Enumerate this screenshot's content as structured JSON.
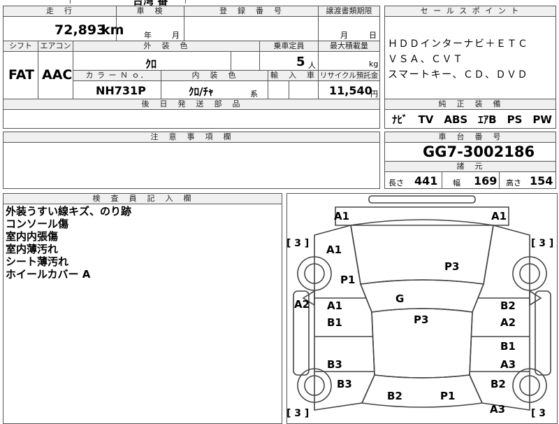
{
  "top_partial": {
    "text": "台湾 番"
  },
  "mileage": {
    "header": "走　行",
    "value": "72,893",
    "unit": "km"
  },
  "inspection": {
    "header": "車　検",
    "year_unit": "年",
    "month_unit": "月"
  },
  "registration": {
    "header": "登　録　番　号"
  },
  "transfer": {
    "header": "譲渡書類期限",
    "month_unit": "月",
    "day_unit": "日"
  },
  "shift": {
    "header": "シフト",
    "value": "FAT"
  },
  "aircon": {
    "header": "エアコン",
    "value": "AAC"
  },
  "exterior_color": {
    "header": "外　装　色",
    "value": "ｸﾛ"
  },
  "capacity": {
    "header": "乗車定員",
    "value": "5",
    "unit": "人"
  },
  "max_load": {
    "header": "最大積載量",
    "unit": "kg"
  },
  "color_no": {
    "header": "カ ラ ー Ｎ ｏ．",
    "value": "NH731P"
  },
  "interior_color": {
    "header": "内　装　色",
    "value": "ｸﾛ/ﾁｬ",
    "suffix": "系"
  },
  "import_car": {
    "header": "輸　入　車"
  },
  "recycle": {
    "header": "リサイクル預託金",
    "value": "11,540",
    "unit": "円"
  },
  "later_parts": {
    "header": "後　日　発　送　部　品"
  },
  "sales_point": {
    "header": "セ ー ル ス ポ イ ン ト",
    "lines": [
      "ＨＤＤインターナビ＋ＥＴＣ",
      "ＶＳＡ、ＣＶＴ",
      "スマートキー、ＣＤ、ＤＶＤ"
    ]
  },
  "equipment": {
    "header": "純　正　装　備",
    "value": "ﾅﾋﾞ　TV　ABS　ｴｱB　PS　PW"
  },
  "notes": {
    "header": "注　意　事　項　欄"
  },
  "chassis": {
    "header": "車　台　番　号",
    "value": "GG7-3002186"
  },
  "specs": {
    "header": "諸　元",
    "length_label": "長さ",
    "length": "441",
    "width_label": "幅",
    "width": "169",
    "height_label": "高さ",
    "height": "154"
  },
  "inspector": {
    "header": "検　査　員　記　入　欄",
    "lines": [
      "外装うすい線キズ、のり跡",
      "コンソール傷",
      "室内内張傷",
      "室内薄汚れ",
      "シート薄汚れ",
      "ホイールカバー A"
    ]
  },
  "diagram": {
    "marks": {
      "a1_left": "A1",
      "a1_right": "A1",
      "bracket_left": "[ 3 ]",
      "bracket_right": "[ 3 ]",
      "a1_fender": "A1",
      "p3_hood": "P3",
      "p1_left": "P1",
      "g_glass": "G",
      "a2_left": "A2",
      "a1_door": "A1",
      "b1_door": "B1",
      "p3_roof": "P3",
      "b2_door_r": "B2",
      "a2_door_r": "A2",
      "b1_rear_r": "B1",
      "b3_rear_l": "B3",
      "a3_rear_r": "A3",
      "b3_quarter": "B3",
      "b2_quarter_r": "B2",
      "b2_rear": "B2",
      "p1_rear": "P1",
      "a3_bumper": "A3",
      "bracket_bl": "[ 3 ]",
      "bracket_br": "[ 3"
    }
  }
}
